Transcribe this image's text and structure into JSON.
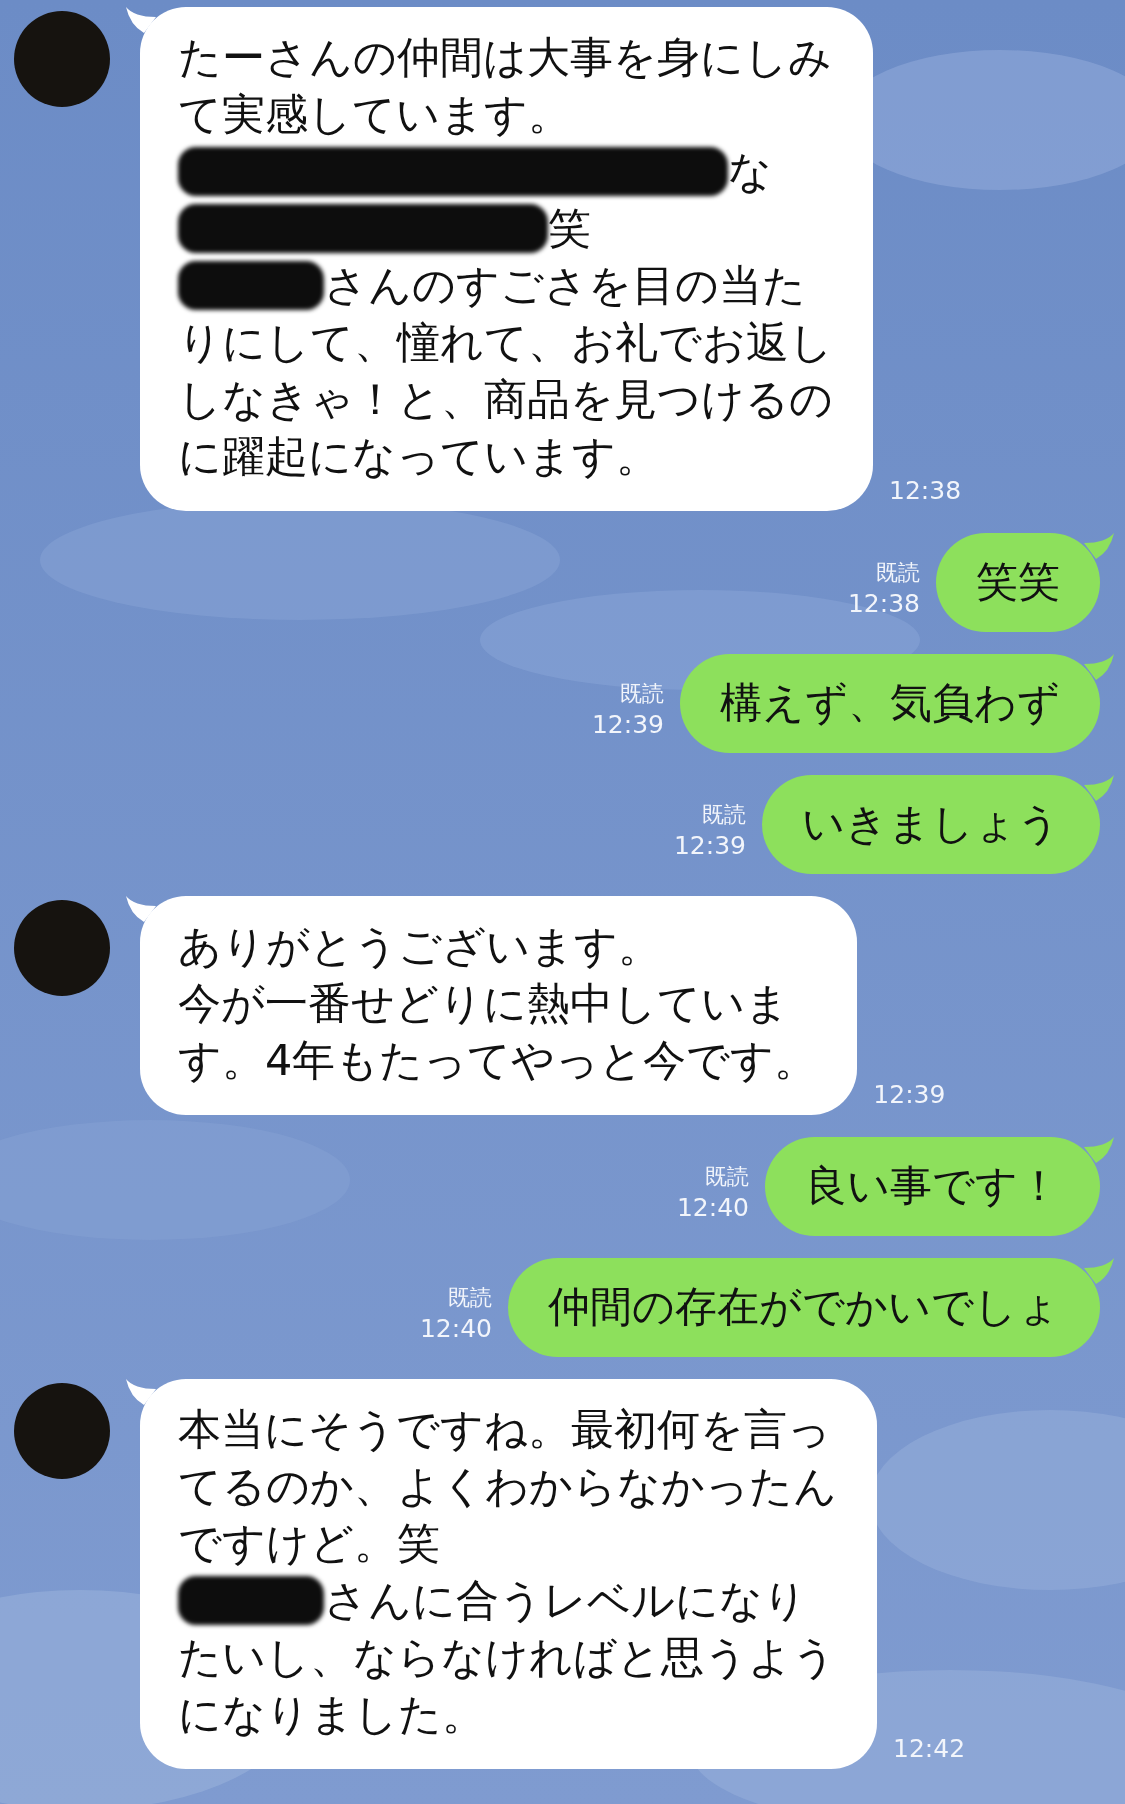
{
  "messages": [
    {
      "kind": "received",
      "time": "12:38",
      "lines": [
        [
          {
            "kind": "text",
            "text": "たーさんの仲間は大事を身にしみ"
          }
        ],
        [
          {
            "kind": "text",
            "text": "て実感しています。"
          }
        ],
        [
          {
            "kind": "redaction_wide"
          },
          {
            "kind": "text",
            "text": "な"
          }
        ],
        [
          {
            "kind": "redaction_medium"
          },
          {
            "kind": "text",
            "text": "笑"
          }
        ],
        [
          {
            "kind": "redaction_narrow"
          },
          {
            "kind": "text",
            "text": "さんのすごさを目の当た"
          }
        ],
        [
          {
            "kind": "text",
            "text": "りにして、憧れて、お礼でお返し"
          }
        ],
        [
          {
            "kind": "text",
            "text": "しなきゃ！と、商品を見つけるの"
          }
        ],
        [
          {
            "kind": "text",
            "text": "に躍起になっています。"
          }
        ]
      ]
    },
    {
      "kind": "sent",
      "read": "既読",
      "time": "12:38",
      "text": "笑笑"
    },
    {
      "kind": "sent",
      "read": "既読",
      "time": "12:39",
      "text": "構えず、気負わず"
    },
    {
      "kind": "sent",
      "read": "既読",
      "time": "12:39",
      "text": "いきましょう"
    },
    {
      "kind": "received",
      "time": "12:39",
      "lines": [
        [
          {
            "kind": "text",
            "text": "ありがとうございます。"
          }
        ],
        [
          {
            "kind": "text",
            "text": "今が一番せどりに熱中していま"
          }
        ],
        [
          {
            "kind": "text",
            "text": "す。4年もたってやっと今です。"
          }
        ]
      ]
    },
    {
      "kind": "sent",
      "read": "既読",
      "time": "12:40",
      "text": "良い事です！"
    },
    {
      "kind": "sent",
      "read": "既読",
      "time": "12:40",
      "text": "仲間の存在がでかいでしょ"
    },
    {
      "kind": "received",
      "time": "12:42",
      "lines": [
        [
          {
            "kind": "text",
            "text": "本当にそうですね。最初何を言っ"
          }
        ],
        [
          {
            "kind": "text",
            "text": "てるのか、よくわからなかったん"
          }
        ],
        [
          {
            "kind": "text",
            "text": "ですけど。笑"
          }
        ],
        [
          {
            "kind": "redaction_narrow"
          },
          {
            "kind": "text",
            "text": "さんに合うレベルになり"
          }
        ],
        [
          {
            "kind": "text",
            "text": "たいし、ならなければと思うよう"
          }
        ],
        [
          {
            "kind": "text",
            "text": "になりました。"
          }
        ]
      ]
    }
  ]
}
